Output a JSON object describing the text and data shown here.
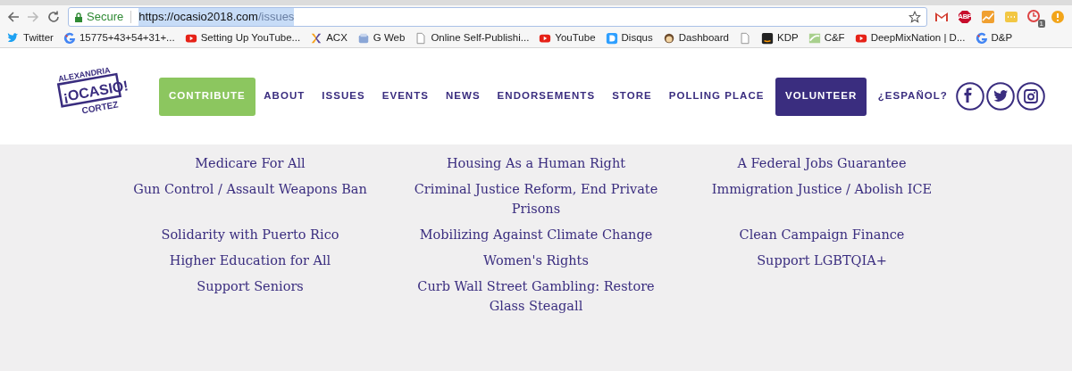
{
  "browser": {
    "security": "Secure",
    "url_host": "https://ocasio2018.com",
    "url_path": "/issues",
    "bookmarks": [
      {
        "kind": "labeled",
        "label": "Twitter"
      },
      {
        "kind": "labeled",
        "label": "15775+43+54+31+..."
      },
      {
        "kind": "labeled",
        "label": "Setting Up YouTube..."
      },
      {
        "kind": "labeled",
        "label": "ACX"
      },
      {
        "kind": "labeled",
        "label": "G Web"
      },
      {
        "kind": "labeled",
        "label": "Online Self-Publishi..."
      },
      {
        "kind": "labeled",
        "label": "YouTube"
      },
      {
        "kind": "labeled",
        "label": "Disqus"
      },
      {
        "kind": "labeled",
        "label": "Dashboard"
      },
      {
        "kind": "icon_only"
      },
      {
        "kind": "labeled",
        "label": "KDP"
      },
      {
        "kind": "labeled",
        "label": "C&F"
      },
      {
        "kind": "labeled",
        "label": "DeepMixNation | D..."
      },
      {
        "kind": "labeled",
        "label": "D&P"
      }
    ],
    "extension_label": "ABP",
    "extension_badge": "1"
  },
  "logo": {
    "top": "ALEXANDRIA",
    "main": "¡OCASIO!",
    "bottom": "CORTEZ"
  },
  "nav": [
    {
      "label": "CONTRIBUTE",
      "kind": "green"
    },
    {
      "label": "ABOUT",
      "kind": "link"
    },
    {
      "label": "ISSUES",
      "kind": "link"
    },
    {
      "label": "EVENTS",
      "kind": "link"
    },
    {
      "label": "NEWS",
      "kind": "link"
    },
    {
      "label": "ENDORSEMENTS",
      "kind": "link"
    },
    {
      "label": "STORE",
      "kind": "link"
    },
    {
      "label": "POLLING PLACE",
      "kind": "link"
    },
    {
      "label": "VOLUNTEER",
      "kind": "purple"
    },
    {
      "label": "¿ESPAÑOL?",
      "kind": "link"
    }
  ],
  "issues": [
    "Medicare For All",
    "Housing As a Human Right",
    "A Federal Jobs Guarantee",
    "Gun Control / Assault Weapons Ban",
    "Criminal Justice Reform, End Private Prisons",
    "Immigration Justice / Abolish ICE",
    "Solidarity with Puerto Rico",
    "Mobilizing Against Climate Change",
    "Clean Campaign Finance",
    "Higher Education for All",
    "Women's Rights",
    "Support LGBTQIA+",
    "Support Seniors",
    "Curb Wall Street Gambling: Restore Glass Steagall"
  ]
}
